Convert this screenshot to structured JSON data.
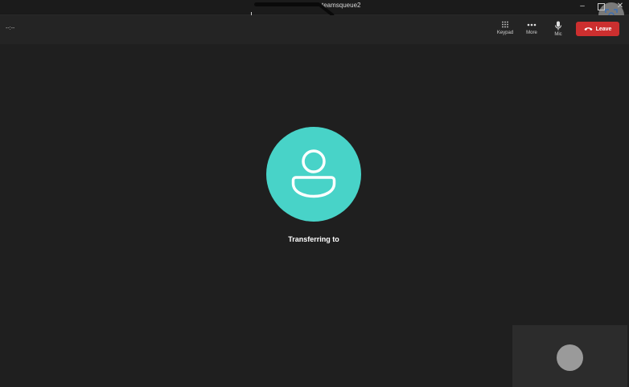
{
  "window": {
    "title_visible": "teamsqueue2",
    "minimize_glyph": "–",
    "close_glyph": "✕"
  },
  "toolbar": {
    "call_timer": "--:--",
    "keypad_label": "Keypad",
    "more_label": "More",
    "mic_label": "Mic",
    "leave_label": "Leave",
    "leave_color": "#cc2f2f"
  },
  "icons": {
    "keypad": "keypad-icon",
    "more": "more-icon",
    "mic": "mic-icon",
    "phone_hangup": "phone-hangup-icon",
    "person": "person-icon",
    "capture": "screen-capture-icon"
  },
  "main": {
    "status_text": "Transferring to",
    "avatar_color": "#48d3c8"
  },
  "self_view": {
    "avatar_color": "#9a9a9a"
  }
}
